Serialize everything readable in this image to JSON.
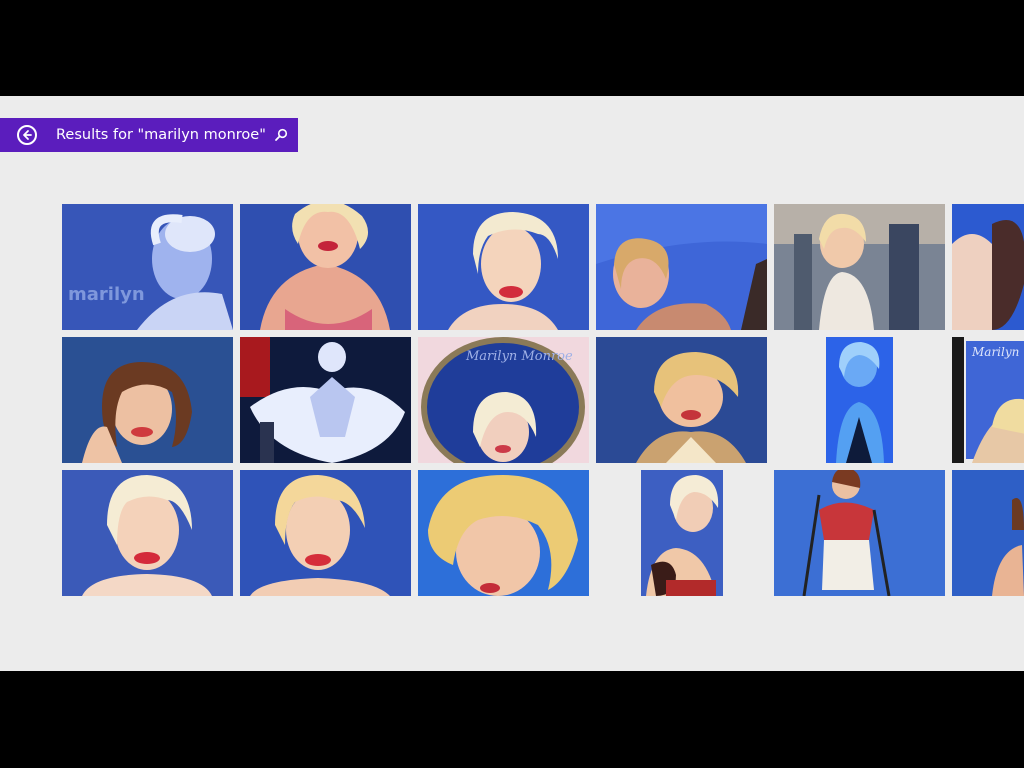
{
  "search": {
    "results_label": "Results for \"marilyn monroe\"",
    "back_icon": "back-arrow-icon",
    "search_icon": "search-icon",
    "accent_color": "#5b1dbd"
  },
  "image_text": {
    "watermark_marilyn": "marilyn",
    "plate_signature": "Marilyn Monroe",
    "stamp_signature": "Marilyn"
  },
  "results_grid": {
    "rows": 3,
    "columns_visible": 6,
    "tile_count": 18
  }
}
